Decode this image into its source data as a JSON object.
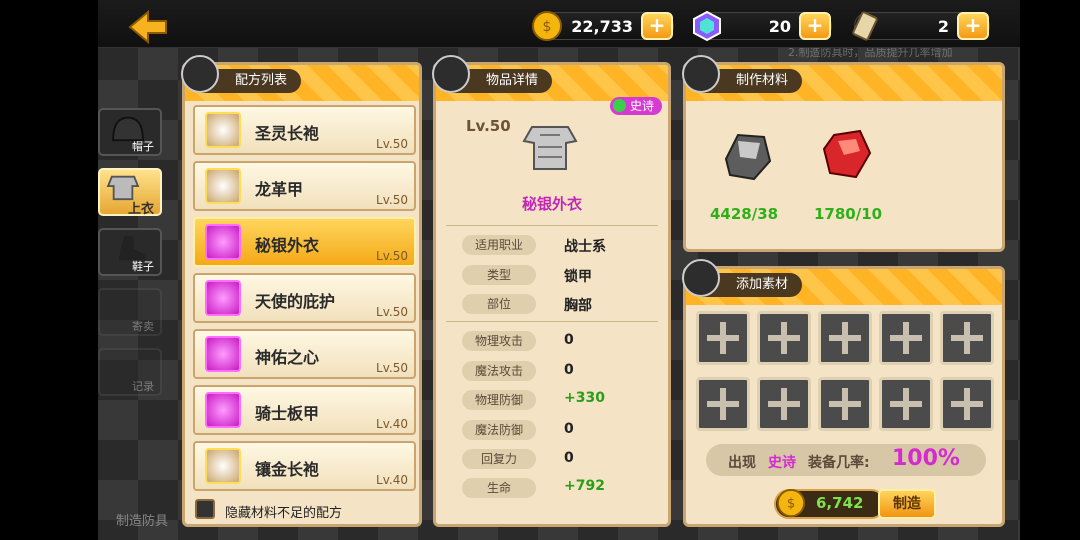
{
  "currencies": [
    {
      "name": "gold",
      "icon": "gold-coin-icon",
      "value": "22,733"
    },
    {
      "name": "gem",
      "icon": "rainbow-gem-icon",
      "value": "20"
    },
    {
      "name": "ticket",
      "icon": "scroll-ticket-icon",
      "value": "2"
    }
  ],
  "categories": [
    {
      "label": "帽子",
      "icon": "helmet-icon"
    },
    {
      "label": "上衣",
      "icon": "armor-icon"
    },
    {
      "label": "鞋子",
      "icon": "boot-icon"
    },
    {
      "label": "寄卖",
      "icon": "consign-icon"
    },
    {
      "label": "记录",
      "icon": "record-icon"
    }
  ],
  "recipe_panel": {
    "title": "配方列表",
    "items": [
      {
        "name": "圣灵长袍",
        "level": "Lv.50"
      },
      {
        "name": "龙革甲",
        "level": "Lv.50"
      },
      {
        "name": "秘银外衣",
        "level": "Lv.50"
      },
      {
        "name": "天使的庇护",
        "level": "Lv.50"
      },
      {
        "name": "神佑之心",
        "level": "Lv.50"
      },
      {
        "name": "骑士板甲",
        "level": "Lv.40"
      },
      {
        "name": "镶金长袍",
        "level": "Lv.40"
      }
    ],
    "hide_label": "隐藏材料不足的配方"
  },
  "detail_panel": {
    "title": "物品详情",
    "rarity": "史诗",
    "level": "Lv.50",
    "item_name": "秘银外衣",
    "info": [
      {
        "label": "适用职业",
        "value": "战士系"
      },
      {
        "label": "类型",
        "value": "锁甲"
      },
      {
        "label": "部位",
        "value": "胸部"
      }
    ],
    "stats": [
      {
        "label": "物理攻击",
        "value": "0"
      },
      {
        "label": "魔法攻击",
        "value": "0"
      },
      {
        "label": "物理防御",
        "value": "+330"
      },
      {
        "label": "魔法防御",
        "value": "0"
      },
      {
        "label": "回复力",
        "value": "0"
      },
      {
        "label": "生命",
        "value": "+792"
      }
    ]
  },
  "materials_panel": {
    "title": "制作材料",
    "items": [
      {
        "icon": "silver-ore-icon",
        "count": "4428/38"
      },
      {
        "icon": "red-crystal-icon",
        "count": "1780/10"
      }
    ]
  },
  "add_panel": {
    "title": "添加素材",
    "chance_prefix": "出现",
    "chance_rarity": "史诗",
    "chance_label": "装备几率:",
    "chance_value": "100%",
    "cost": "6,742",
    "craft_label": "制造"
  },
  "bg_hint": "制造防具",
  "bg_top_hint": "2.制造防具时，品质提升几率增加"
}
